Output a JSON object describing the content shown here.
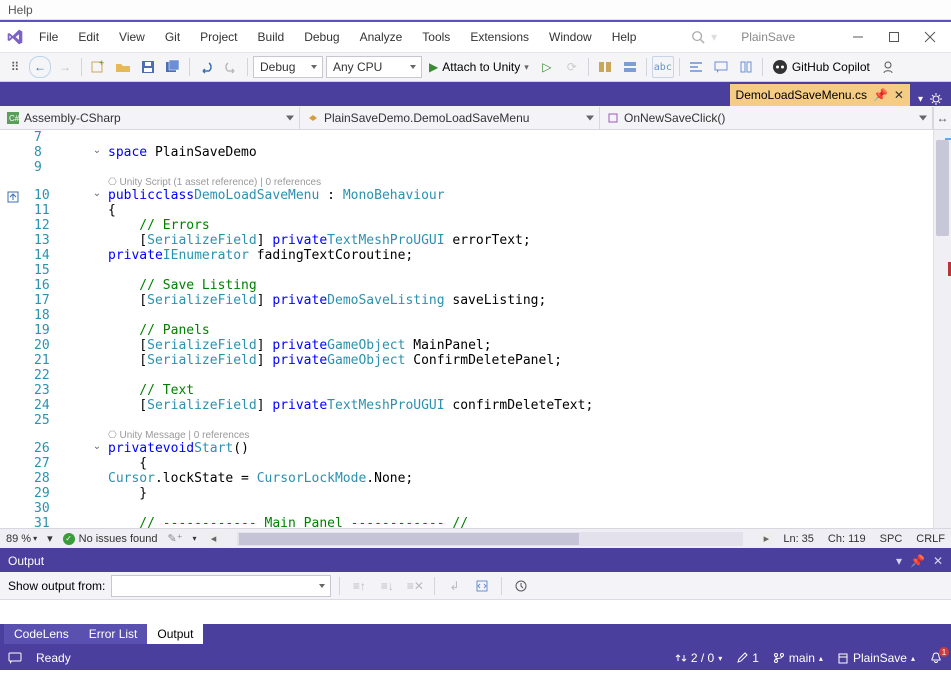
{
  "outerMenu": {
    "help": "Help"
  },
  "menu": [
    "File",
    "Edit",
    "View",
    "Git",
    "Project",
    "Build",
    "Debug",
    "Analyze",
    "Tools",
    "Extensions",
    "Window",
    "Help"
  ],
  "titlebar": {
    "projectName": "PlainSave"
  },
  "toolbar": {
    "configCombo": "Debug",
    "platformCombo": "Any CPU",
    "attachLabel": "Attach to Unity",
    "copilotLabel": "GitHub Copilot"
  },
  "tab": {
    "filename": "DemoLoadSaveMenu.cs"
  },
  "navbar": {
    "scope1": "Assembly-CSharp",
    "scope2": "PlainSaveDemo.DemoLoadSaveMenu",
    "scope3": "OnNewSaveClick()"
  },
  "code": {
    "lens1": "Unity Script (1 asset reference) | 0 references",
    "lens2": "Unity Message | 0 references",
    "lines": [
      {
        "n": 7,
        "t": ""
      },
      {
        "n": 8,
        "t": "space PlainSaveDemo",
        "fold": "v"
      },
      {
        "n": 9,
        "t": ""
      },
      {
        "n": "lens1"
      },
      {
        "n": 10,
        "t": "public class DemoLoadSaveMenu : MonoBehaviour",
        "fold": "v"
      },
      {
        "n": 11,
        "t": "{"
      },
      {
        "n": 12,
        "t": "    // Errors"
      },
      {
        "n": 13,
        "t": "    [SerializeField] private TextMeshProUGUI errorText;"
      },
      {
        "n": 14,
        "t": "    private IEnumerator fadingTextCoroutine;"
      },
      {
        "n": 15,
        "t": ""
      },
      {
        "n": 16,
        "t": "    // Save Listing"
      },
      {
        "n": 17,
        "t": "    [SerializeField] private DemoSaveListing saveListing;"
      },
      {
        "n": 18,
        "t": ""
      },
      {
        "n": 19,
        "t": "    // Panels"
      },
      {
        "n": 20,
        "t": "    [SerializeField] private GameObject MainPanel;"
      },
      {
        "n": 21,
        "t": "    [SerializeField] private GameObject ConfirmDeletePanel;"
      },
      {
        "n": 22,
        "t": ""
      },
      {
        "n": 23,
        "t": "    // Text"
      },
      {
        "n": 24,
        "t": "    [SerializeField] private TextMeshProUGUI confirmDeleteText;"
      },
      {
        "n": 25,
        "t": ""
      },
      {
        "n": "lens2"
      },
      {
        "n": 26,
        "t": "    private void Start()",
        "fold": "v"
      },
      {
        "n": 27,
        "t": "    {"
      },
      {
        "n": 28,
        "t": "        Cursor.lockState = CursorLockMode.None;"
      },
      {
        "n": 29,
        "t": "    }"
      },
      {
        "n": 30,
        "t": ""
      },
      {
        "n": 31,
        "t": "    // ------------ Main Panel ------------ //"
      }
    ]
  },
  "editstrip": {
    "zoom": "89 %",
    "issues": "No issues found",
    "ln": "Ln: 35",
    "ch": "Ch: 119",
    "ins": "SPC",
    "eol": "CRLF"
  },
  "output": {
    "title": "Output",
    "showFrom": "Show output from:",
    "tabs": [
      "CodeLens",
      "Error List",
      "Output"
    ],
    "activeTab": 2
  },
  "statusbar": {
    "ready": "Ready",
    "updown": "2 / 0",
    "pencil": "1",
    "branch": "main",
    "project": "PlainSave",
    "bell": "1"
  }
}
